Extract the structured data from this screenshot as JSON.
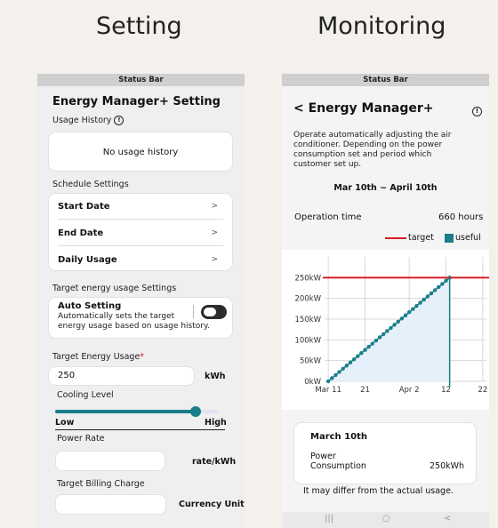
{
  "headings": {
    "setting": "Setting",
    "monitoring": "Monitoring"
  },
  "left": {
    "status_bar": "Status Bar",
    "title": "Energy Manager+ Setting",
    "usage_history_label": "Usage History",
    "no_usage_history": "No usage history",
    "schedule_label": "Schedule Settings",
    "schedule_rows": [
      {
        "label": "Start Date",
        "chevron": ">"
      },
      {
        "label": "End Date",
        "chevron": ">"
      },
      {
        "label": "Daily Usage",
        "chevron": ">"
      }
    ],
    "target_settings_label": "Target energy usage Settings",
    "auto_setting_title": "Auto Setting",
    "auto_setting_desc1": "Automatically sets the target",
    "auto_setting_desc2": "energy usage based on usage history.",
    "target_energy_label": "Target Energy Usage",
    "required_mark": "*",
    "target_energy_value": "250",
    "target_energy_unit": "kWh",
    "cooling_label": "Cooling Level",
    "cooling_level": 0.86,
    "low_label": "Low",
    "high_label": "High",
    "power_rate_label": "Power Rate",
    "power_rate_value": "",
    "power_rate_unit": "rate/kWh",
    "billing_label": "Target Billing Charge",
    "billing_value": "",
    "billing_unit": "Currency Unit"
  },
  "right": {
    "status_bar": "Status Bar",
    "back": "<",
    "title": "Energy Manager+",
    "desc1": "Operate automatically adjusting the air",
    "desc2": "conditioner. Depending on the power",
    "desc3": "consumption set and period which",
    "desc4": "customer set up.",
    "period": "Mar 10th ~ April 10th",
    "op_time_label": "Operation time",
    "op_time_value": "660 hours",
    "legend_target": "target",
    "legend_useful": "useful",
    "card_date": "March 10th",
    "card_label1": "Power",
    "card_label2": "Consumption",
    "card_value": "250kWh",
    "footnote": "It may differ from the actual usage.",
    "nav": {
      "recent": "|||",
      "home": "○",
      "back": "<"
    }
  },
  "colors": {
    "accent": "#1b7f8b",
    "target_line": "#d31f26",
    "required": "#d31f26",
    "area_fill": "#e6f0fb"
  },
  "chart_data": {
    "type": "line",
    "x_tick_labels": [
      "Mar 11",
      "21",
      "Apr 2",
      "12",
      "22"
    ],
    "x_tick_days": [
      1,
      11,
      23,
      33,
      43
    ],
    "y_tick_labels": [
      "0kW",
      "50kW",
      "100kW",
      "150kW",
      "200kW",
      "250kW"
    ],
    "y_ticks": [
      0,
      50,
      100,
      150,
      200,
      250
    ],
    "ylim": [
      0,
      300
    ],
    "xlim": [
      0,
      44
    ],
    "target": 250,
    "current_day": 34,
    "series": [
      {
        "name": "useful",
        "start_day": 1,
        "end_day": 34,
        "start_value": 0,
        "end_value": 250,
        "points": 34
      }
    ],
    "grid": true,
    "legend": "top-right"
  }
}
